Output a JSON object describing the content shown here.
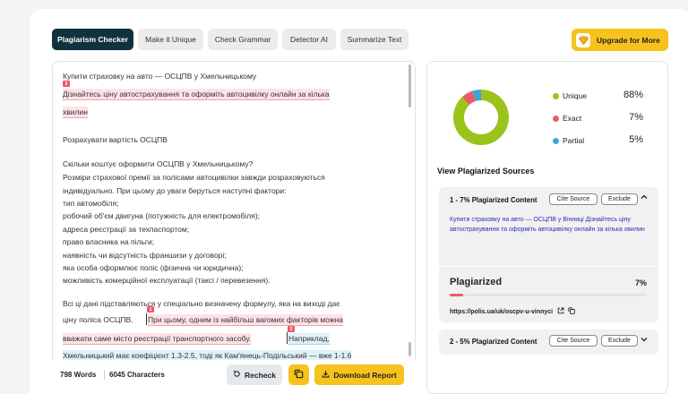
{
  "tabs": [
    {
      "label": "Plagiarism Checker",
      "active": true
    },
    {
      "label": "Make it Unique",
      "active": false
    },
    {
      "label": "Check Grammar",
      "active": false
    },
    {
      "label": "Detector AI",
      "active": false
    },
    {
      "label": "Summarize Text",
      "active": false
    }
  ],
  "upgrade_label": "Upgrade for More",
  "editor": {
    "lines": [
      "Купити страховку на авто — ОСЦПВ у Хмельницькому",
      "Дізнайтесь ціну автострахування та оформіть автоцивілку онлайн за кілька",
      "хвилин",
      "Розрахувати вартість ОСЦПВ",
      "Скільки коштує оформити ОСЦПВ у Хмельницькому?",
      "Розміри страхової премії за полісами автоцивілки завжди розраховуються",
      "індивідуально. При цьому до уваги беруться наступні фактори:",
      "тип автомобіля;",
      "робочий об'єм двигуна (потужність для електромобіля);",
      "адреса реєстрації за техпаспортом;",
      "право власника на пільги;",
      "наявність чи відсутність франшизи у договорі;",
      "яка особа оформлює поліс (фізична чи юридична);",
      "можливість комерційної експлуатації (таксі / перевезення).",
      "Всі ці дані підставляються у спеціально визначену формулу, яка на виході дає",
      "ціну поліса ОСЦПВ.",
      "При цьому, одним із найбільш вагомих факторів можна",
      "вважати саме місто реєстрації транспортного засобу.",
      "Наприклад,",
      "Хмельницький має коефіцієнт 1.3-2.5, тоді як Кам'янець-Подільський — вже 1-1.6"
    ],
    "markers": [
      "2",
      "1",
      "2"
    ],
    "word_count": "798 Words",
    "char_count": "6045 Characters",
    "recheck_label": "Recheck",
    "download_label": "Download Report"
  },
  "results": {
    "stats": [
      {
        "label": "Unique",
        "value": "88%",
        "color": "#9cc31c"
      },
      {
        "label": "Exact",
        "value": "7%",
        "color": "#ec5a6a"
      },
      {
        "label": "Partial",
        "value": "5%",
        "color": "#3aa7d9"
      }
    ],
    "sources_title": "View Plagiarized Sources",
    "sources": [
      {
        "heading": "1 - 7% Plagiarized Content",
        "text": "Купити страховку на авто — ОСЦПВ у Вінниці Дізнайтесь ціну автострахування та оформіть автоцивілку онлайн за кілька хвилин",
        "plag_label": "Plagiarized",
        "plag_value": "7%",
        "plag_fraction": 0.07,
        "url": "https://polis.ua/uk/oscpv-u-vinnyci",
        "expanded": true
      },
      {
        "heading": "2 - 5% Plagiarized Content",
        "expanded": false
      }
    ],
    "cite_label": "Cite Source",
    "exclude_label": "Exclude"
  }
}
